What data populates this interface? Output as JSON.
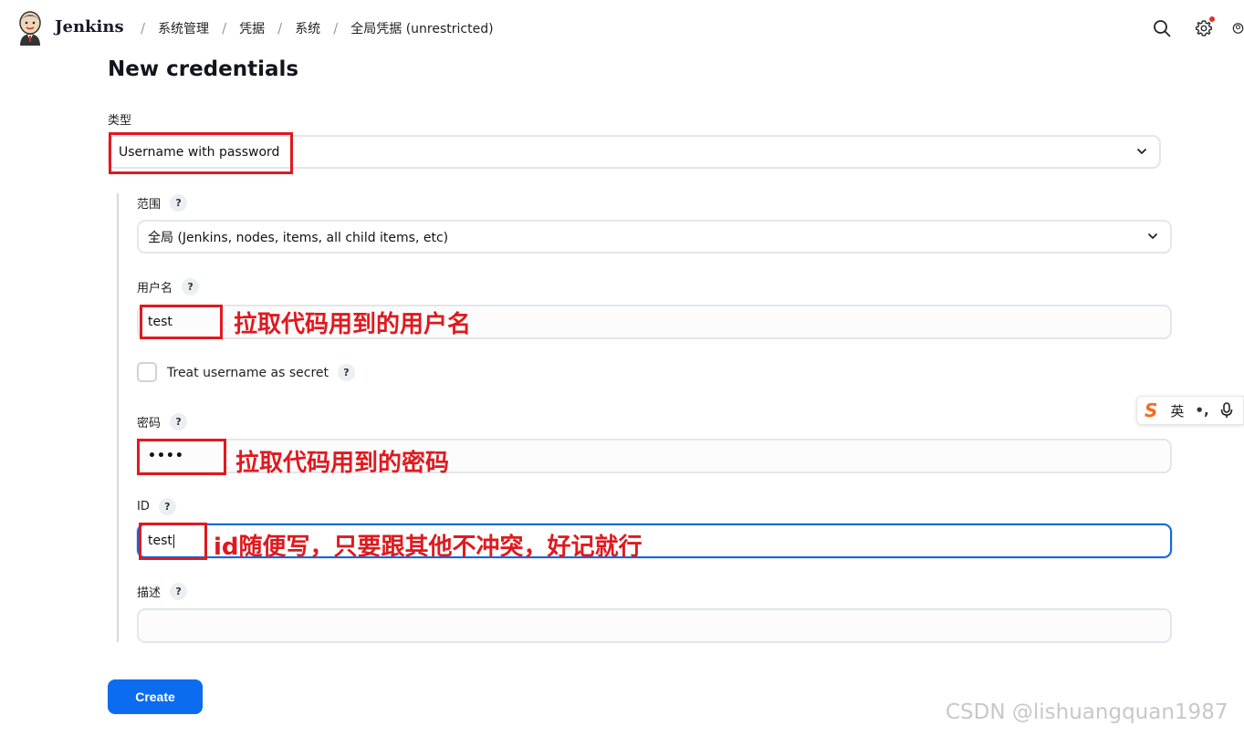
{
  "header": {
    "brand": "Jenkins",
    "breadcrumbs": [
      "系统管理",
      "凭据",
      "系统",
      "全局凭据 (unrestricted)"
    ]
  },
  "page": {
    "title": "New credentials"
  },
  "form": {
    "type_label": "类型",
    "type_value": "Username with password",
    "scope_label": "范围",
    "scope_value": "全局 (Jenkins, nodes, items, all child items, etc)",
    "username_label": "用户名",
    "username_value": "test",
    "treat_secret_label": "Treat username as secret",
    "password_label": "密码",
    "password_value": "••••",
    "id_label": "ID",
    "id_value": "test",
    "description_label": "描述",
    "description_value": "",
    "help_glyph": "?",
    "create_label": "Create"
  },
  "annotations": {
    "username_note": "拉取代码用到的用户名",
    "password_note": "拉取代码用到的密码",
    "id_note": "id随便写，只要跟其他不冲突，好记就行"
  },
  "ime_toolbar": {
    "logo": "S",
    "mode": "英",
    "punct": "•,"
  },
  "watermark": "CSDN @lishuangquan1987",
  "colors": {
    "accent": "#0b6cf0",
    "focus_border": "#1468d9",
    "annotation_red": "#e0191e",
    "notification_dot": "#e0312f"
  },
  "icons": [
    "jenkins-logo-icon",
    "search-icon",
    "gear-icon",
    "chevron-down-icon",
    "microphone-icon"
  ]
}
